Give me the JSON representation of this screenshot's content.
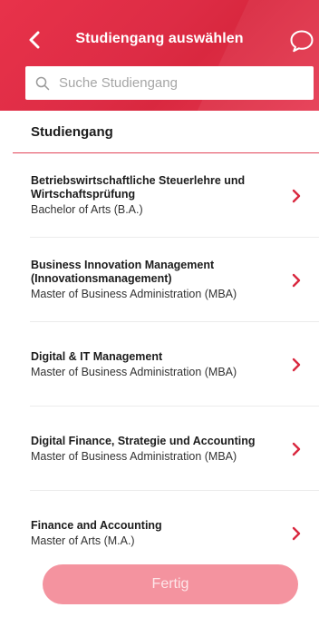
{
  "header": {
    "title": "Studiengang auswählen",
    "back_icon": "chevron-left-icon",
    "chat_icon": "chat-bubble-icon",
    "background": "#e2304a"
  },
  "search": {
    "placeholder": "Suche Studiengang",
    "value": ""
  },
  "section": {
    "title": "Studiengang"
  },
  "programs": [
    {
      "name": "Betriebswirtschaftliche Steuerlehre und Wirtschaftsprüfung",
      "degree": "Bachelor of Arts (B.A.)"
    },
    {
      "name": "Business Innovation Management (Innovationsmanagement)",
      "degree": "Master of Business Administration (MBA)"
    },
    {
      "name": "Digital & IT Management",
      "degree": "Master of Business Administration (MBA)"
    },
    {
      "name": "Digital Finance, Strategie und Accounting",
      "degree": "Master of Business Administration (MBA)"
    },
    {
      "name": "Finance and Accounting",
      "degree": "Master of Arts (M.A.)"
    }
  ],
  "footer": {
    "done_label": "Fertig",
    "done_enabled": false
  },
  "colors": {
    "accent": "#e2304a",
    "chevron": "#d9283f",
    "button_disabled": "#f4939f"
  }
}
